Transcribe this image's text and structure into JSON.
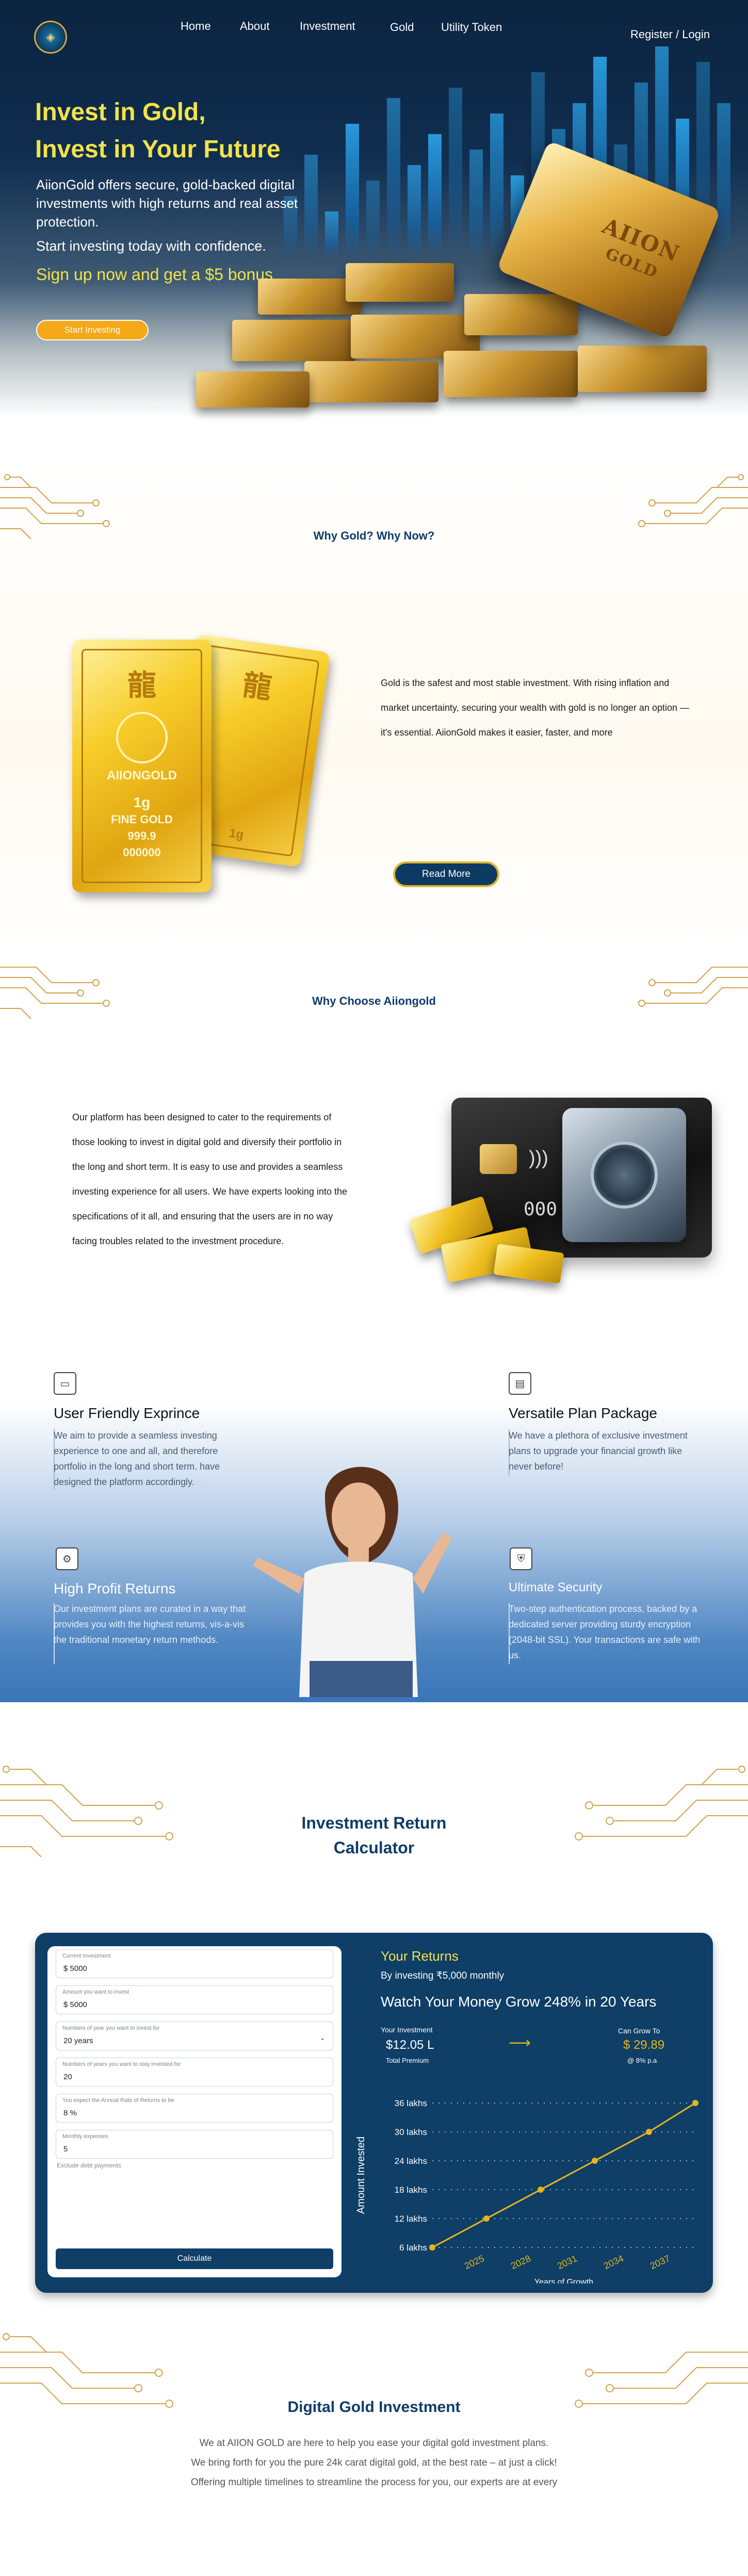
{
  "brand": {
    "logo_icon": "aiion-gold-logo"
  },
  "nav": {
    "items": [
      "Home",
      "About",
      "Investment",
      "Gold",
      "Utility Token"
    ],
    "register": "Register / Login"
  },
  "hero": {
    "title_line1": "Invest in Gold,",
    "title_line2": "Invest in Your Future",
    "description": "AiionGold offers secure, gold-backed digital investments with high returns and real asset protection.",
    "description2": "Start investing today with confidence.",
    "signup": "Sign up now and get a $5 bonus",
    "start_button": "Start Investing",
    "bar_brand": "AIION",
    "bar_brand2": "GOLD"
  },
  "why_gold": {
    "title": "Why Gold? Why Now?",
    "paragraph": "Gold is the safest and most stable investment. With rising inflation and market uncertainty, securing your wealth with gold is no longer an option —it's essential. AiionGold makes it easier, faster, and more",
    "read_more": "Read More",
    "card": {
      "glyph": "龍",
      "brand": "AIIONGOLD",
      "weight": "1g",
      "purity": "FINE GOLD",
      "assay": "999.9",
      "serial": "000000",
      "back_weight": "1g"
    }
  },
  "why_choose": {
    "title": "Why Choose Aiiongold",
    "paragraph": "Our platform has been designed to cater to the requirements of those looking to invest in digital gold and diversify their portfolio in the long and short term. It is easy to use and provides a seamless investing experience for all users. We have experts looking into the specifications of it all, and ensuring that the users are in no way facing troubles related to the investment procedure.",
    "card_number": "000 0000"
  },
  "features": [
    {
      "icon": "browser-icon",
      "title": "User Friendly Exprince",
      "text": "We aim to provide a seamless investing experience to one and all, and therefore portfolio in the long and short term. have designed the platform accordingly."
    },
    {
      "icon": "package-icon",
      "title": "Versatile Plan Package",
      "text": "We have a plethora of exclusive investment plans to upgrade your financial growth like never before!"
    },
    {
      "icon": "profit-icon",
      "title": "High Profit Returns",
      "text": "Our investment plans are curated in a way that provides you with the highest returns, vis-a-vis the traditional monetary return methods."
    },
    {
      "icon": "shield-icon",
      "title": "Ultimate Security",
      "text": "Two-step authentication process, backed by a dedicated server providing sturdy encryption (2048-bit SSL). Your transactions are safe with us."
    }
  ],
  "calculator": {
    "title_line1": "Investment Return",
    "title_line2": "Calculator",
    "fields": [
      {
        "label": "Current Investment",
        "value": "$  5000"
      },
      {
        "label": "Amount you want to invest",
        "value": "$  5000"
      },
      {
        "label": "Numbers of year you want to invest for",
        "value": "20 years"
      },
      {
        "label": "Numbers of years you want to stay invested for",
        "value": "20"
      },
      {
        "label": "You expect the Annual Rate of Returns to be",
        "value": "8 %"
      },
      {
        "label": "Monthly expenses",
        "value": "5"
      }
    ],
    "exclude_label": "Exclude debt payments",
    "button": "Calculate",
    "results": {
      "heading": "Your Returns",
      "subheading": "By investing ₹5,000 monthly",
      "headline": "Watch Your Money Grow 248% in 20 Years",
      "your_investment_label": "Your Investment",
      "your_investment_value": "$12.05 L",
      "total_premium": "Total Premium",
      "can_grow_label": "Can Grow To",
      "can_grow_value": "$ 29.89",
      "rate": "@ 8% p.a"
    }
  },
  "chart_data": {
    "type": "line",
    "x": [
      "2025",
      "2028",
      "2031",
      "2034",
      "2037"
    ],
    "series": [
      {
        "values": [
          6,
          12,
          18,
          24,
          30,
          36
        ]
      }
    ],
    "series_x": [
      2023,
      2026.5,
      2030,
      2033.5,
      2037,
      2040
    ],
    "y_ticks": [
      "6 lakhs",
      "12 lakhs",
      "18 lakhs",
      "24 lakhs",
      "30 lakhs",
      "36 lakhs"
    ],
    "xlabel": "Years of Growth",
    "ylabel": "Amount Invested",
    "ylim": [
      6,
      36
    ],
    "line_color": "#e5b51c",
    "grid": "dotted"
  },
  "digital_gold": {
    "title": "Digital Gold Investment",
    "lines": [
      "We at AIION GOLD are here to help you ease your digital gold investment plans.",
      "We bring forth for you the pure 24k carat digital gold, at the best rate – at just a click!",
      "Offering multiple timelines to streamline the process for you, our experts are at every"
    ]
  },
  "colors": {
    "navy": "#0f3c68",
    "gold": "#f2e24b",
    "orange": "#f5a818"
  }
}
